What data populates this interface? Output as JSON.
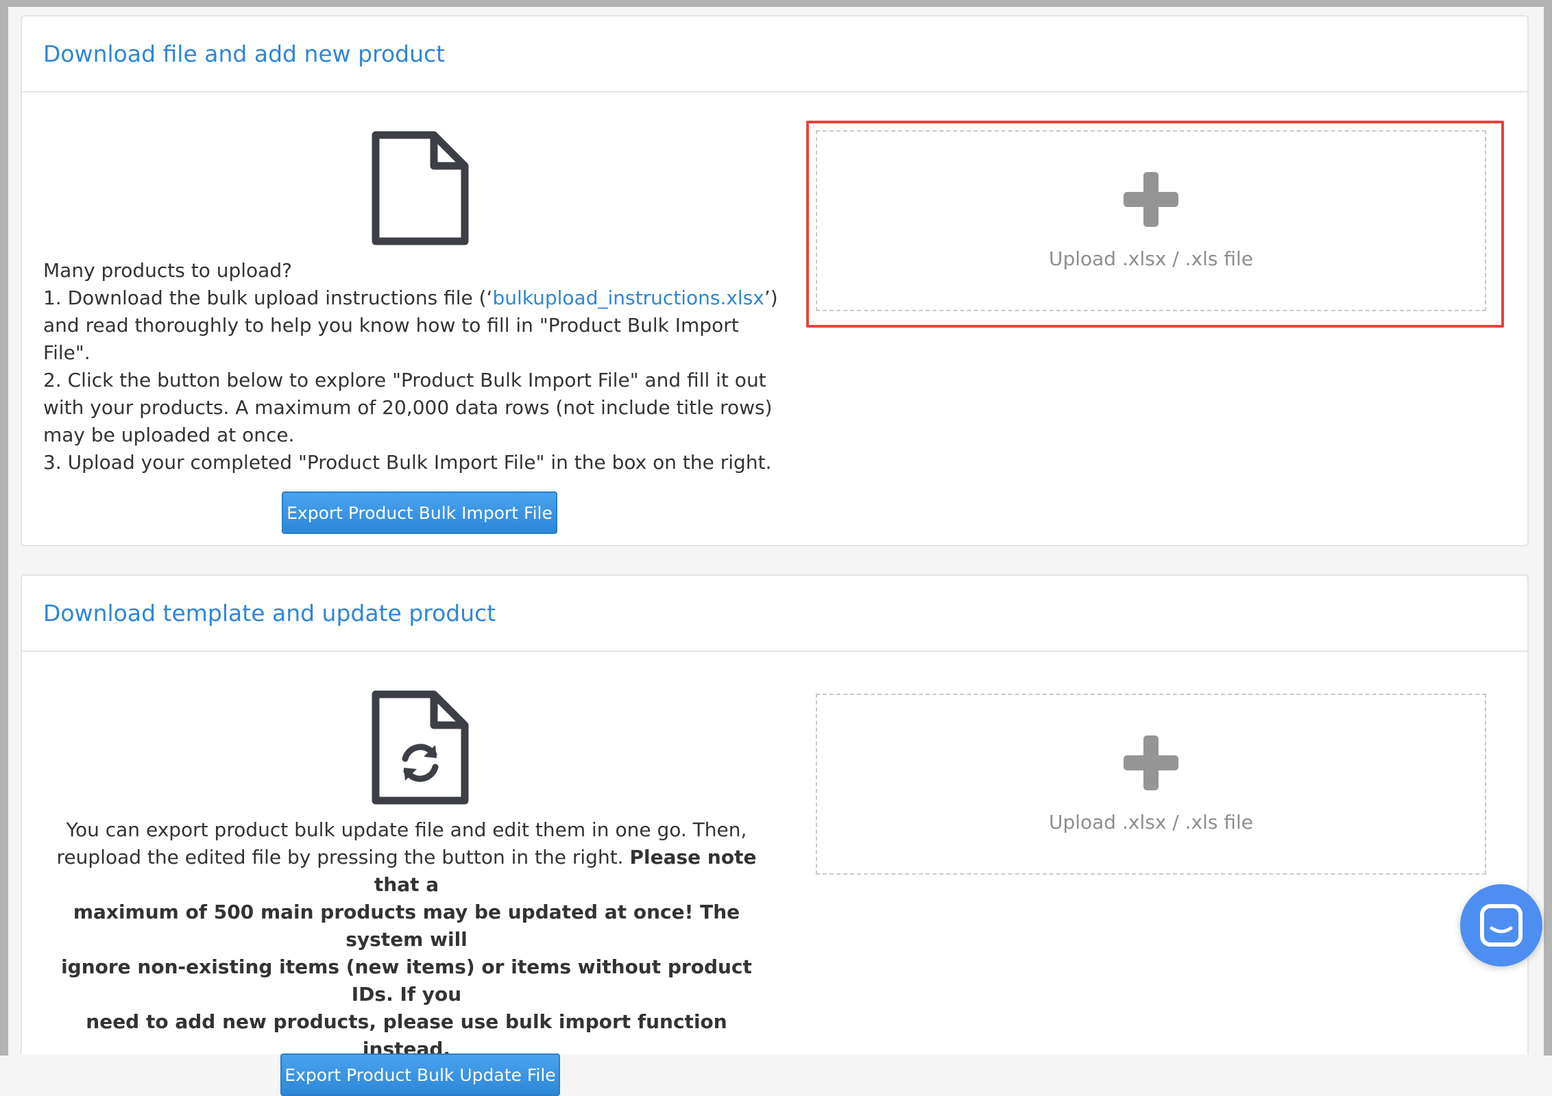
{
  "section_new": {
    "title": "Download file and add new product",
    "intro": "Many products to upload?",
    "step1_before": "1. Download the bulk upload instructions file (‘",
    "step1_link": "bulkupload_instructions.xlsx",
    "step1_after": "’)",
    "step1_line2": "and read thoroughly to help you know how to fill in \"Product Bulk Import File\".",
    "step2_line1": "2. Click the button below to explore \"Product Bulk Import File\" and fill it out",
    "step2_line2": "with your products. A maximum of 20,000 data rows (not include title rows)",
    "step2_line3": "may be uploaded at once.",
    "step3": "3. Upload your completed \"Product Bulk Import File\" in the box on the right.",
    "button_label": "Export Product Bulk Import File",
    "upload_label": "Upload .xlsx / .xls file"
  },
  "section_update": {
    "title": "Download template and update product",
    "line1": "You can export product bulk update file and edit them in one go. Then,",
    "line2_normal": "reupload the edited file by pressing the button in the right. ",
    "line2_bold": "Please note that a",
    "line3": "maximum of 500 main products may be updated at once! The system will",
    "line4": "ignore non-existing items (new items) or items without product IDs. If you",
    "line5": "need to add new products, please use bulk import function instead.",
    "button_label": "Export Product Bulk Update File",
    "upload_label": "Upload .xlsx / .xls file"
  },
  "icons": {
    "file": "file-icon",
    "file_sync": "file-sync-icon",
    "plus": "plus-icon",
    "chat": "chat-icon"
  },
  "colors": {
    "accent": "#2f86d6",
    "highlight": "#e5463a",
    "chat": "#4d8ef2"
  }
}
